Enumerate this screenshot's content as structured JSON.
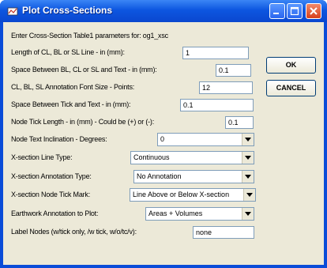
{
  "window": {
    "title": "Plot Cross-Sections",
    "minimize_icon": "minimize-icon",
    "maximize_icon": "maximize-icon",
    "close_icon": "close-icon"
  },
  "intro": "Enter Cross-Section Table1 parameters for: og1_xsc",
  "fields": {
    "length": {
      "label": "Length of CL, BL or SL Line - in (mm):",
      "value": "1"
    },
    "space_bl": {
      "label": "Space Between BL, CL or SL and Text - in (mm):",
      "value": "0.1"
    },
    "font_size": {
      "label": "CL, BL, SL Annotation Font Size - Points:",
      "value": "12"
    },
    "space_tick": {
      "label": "Space Between Tick and Text - in (mm):",
      "value": "0.1"
    },
    "node_tick": {
      "label": "Node Tick Length - in (mm) - Could be (+) or (-):",
      "value": "0.1"
    },
    "node_text_incl": {
      "label": "Node Text Inclination - Degrees:",
      "value": "0"
    },
    "line_type": {
      "label": "X-section Line Type:",
      "value": "Continuous"
    },
    "annotation_type": {
      "label": "X-section Annotation Type:",
      "value": "No Annotation"
    },
    "node_tick_mark": {
      "label": "X-section Node Tick Mark:",
      "value": "Line Above or Below X-section"
    },
    "earthwork": {
      "label": "Earthwork Annotation to Plot:",
      "value": "Areas + Volumes"
    },
    "label_nodes": {
      "label": "Label Nodes (w/tick only, /w tick, w/o/tc/v):",
      "value": "none"
    }
  },
  "buttons": {
    "ok": "OK",
    "cancel": "CANCEL"
  },
  "icons": {
    "dropdown": "chevron-down-icon"
  },
  "colors": {
    "titlebar": "#0a4cd8",
    "dialog_bg": "#ece9d8",
    "close_button": "#d8401c"
  }
}
